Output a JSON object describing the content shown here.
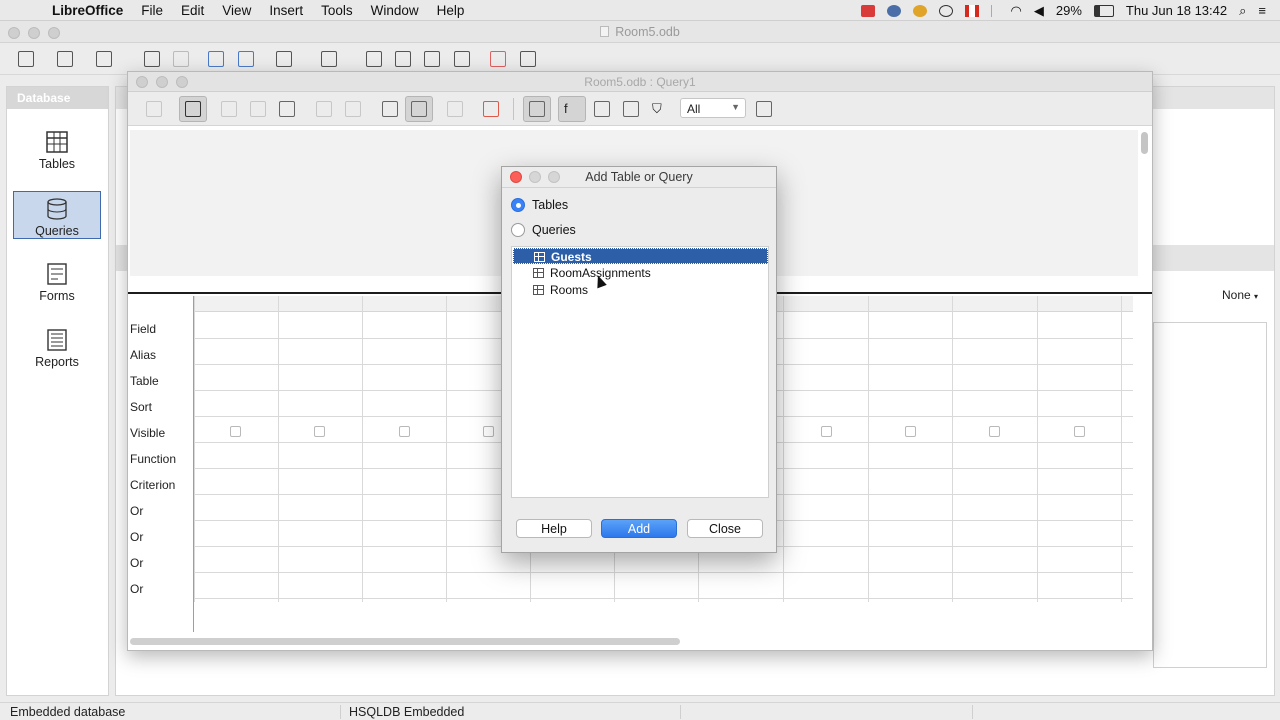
{
  "menubar": {
    "app": "LibreOffice",
    "items": [
      "File",
      "Edit",
      "View",
      "Insert",
      "Tools",
      "Window",
      "Help"
    ],
    "battery": "29%",
    "clock": "Thu Jun 18  13:42"
  },
  "main_window": {
    "title": "Room5.odb"
  },
  "db_panel": {
    "header": "Database",
    "items": [
      {
        "label": "Tables",
        "icon": "table-icon"
      },
      {
        "label": "Queries",
        "icon": "database-icon",
        "selected": true
      },
      {
        "label": "Forms",
        "icon": "form-icon"
      },
      {
        "label": "Reports",
        "icon": "report-icon"
      }
    ]
  },
  "right_panel": {
    "preview_select": "None"
  },
  "query_window": {
    "title": "Room5.odb : Query1",
    "limit_select": "All",
    "grid_rows": [
      "Field",
      "Alias",
      "Table",
      "Sort",
      "Visible",
      "Function",
      "Criterion",
      "Or",
      "Or",
      "Or",
      "Or"
    ]
  },
  "dialog": {
    "title": "Add Table or Query",
    "radio_tables": "Tables",
    "radio_queries": "Queries",
    "items": [
      "Guests",
      "RoomAssignments",
      "Rooms"
    ],
    "selected_item": "Guests",
    "btn_help": "Help",
    "btn_add": "Add",
    "btn_close": "Close"
  },
  "statusbar": {
    "left": "Embedded database",
    "middle": "HSQLDB Embedded"
  }
}
